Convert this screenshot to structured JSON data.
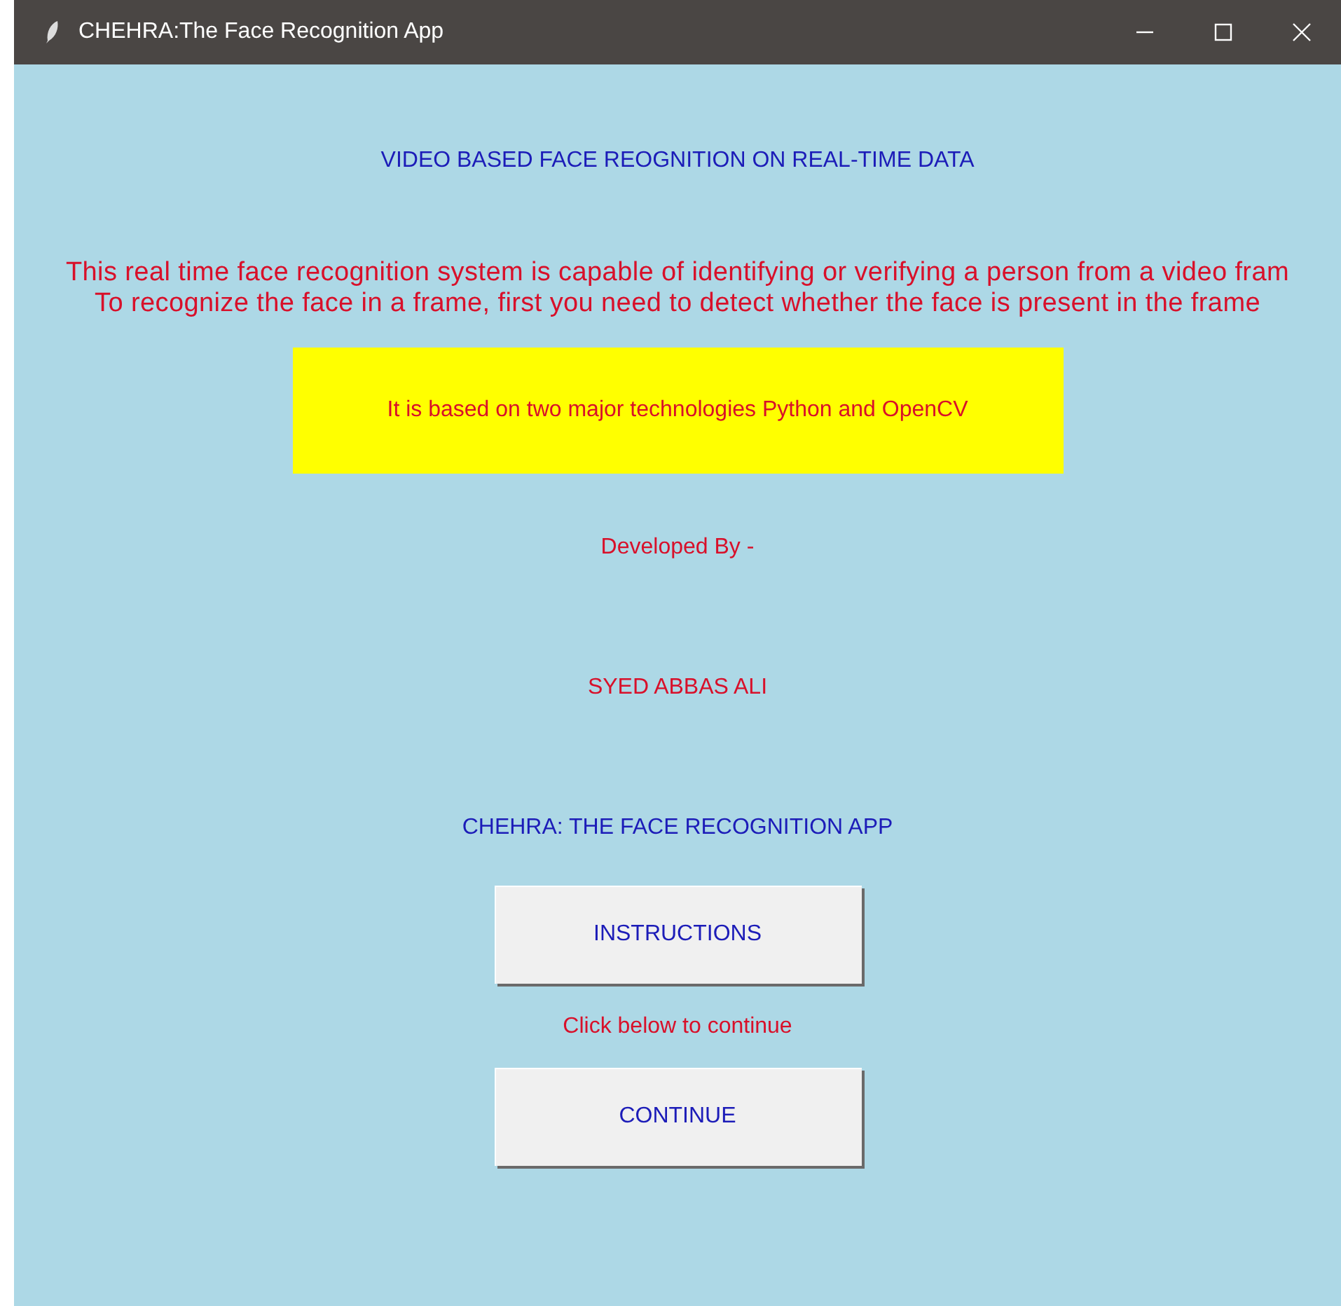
{
  "window": {
    "title": "CHEHRA:The Face Recognition App"
  },
  "content": [
    {
      "kind": "heading",
      "text": "VIDEO BASED FACE REOGNITION ON REAL-TIME DATA"
    },
    {
      "kind": "paragraph",
      "lines": [
        "This real time face recognition system is capable of identifying or verifying a person from a video fram",
        "To recognize the face in a frame, first you need to detect whether the face is present in the frame"
      ]
    },
    {
      "kind": "banner",
      "text": "It is based on two major technologies Python and OpenCV"
    },
    {
      "kind": "text",
      "text": "Developed By -"
    },
    {
      "kind": "text",
      "text": "SYED ABBAS ALI"
    },
    {
      "kind": "heading",
      "text": "CHEHRA: THE FACE RECOGNITION APP"
    },
    {
      "kind": "button",
      "text": "INSTRUCTIONS"
    },
    {
      "kind": "text",
      "text": "Click below to continue"
    },
    {
      "kind": "button",
      "text": "CONTINUE"
    }
  ]
}
